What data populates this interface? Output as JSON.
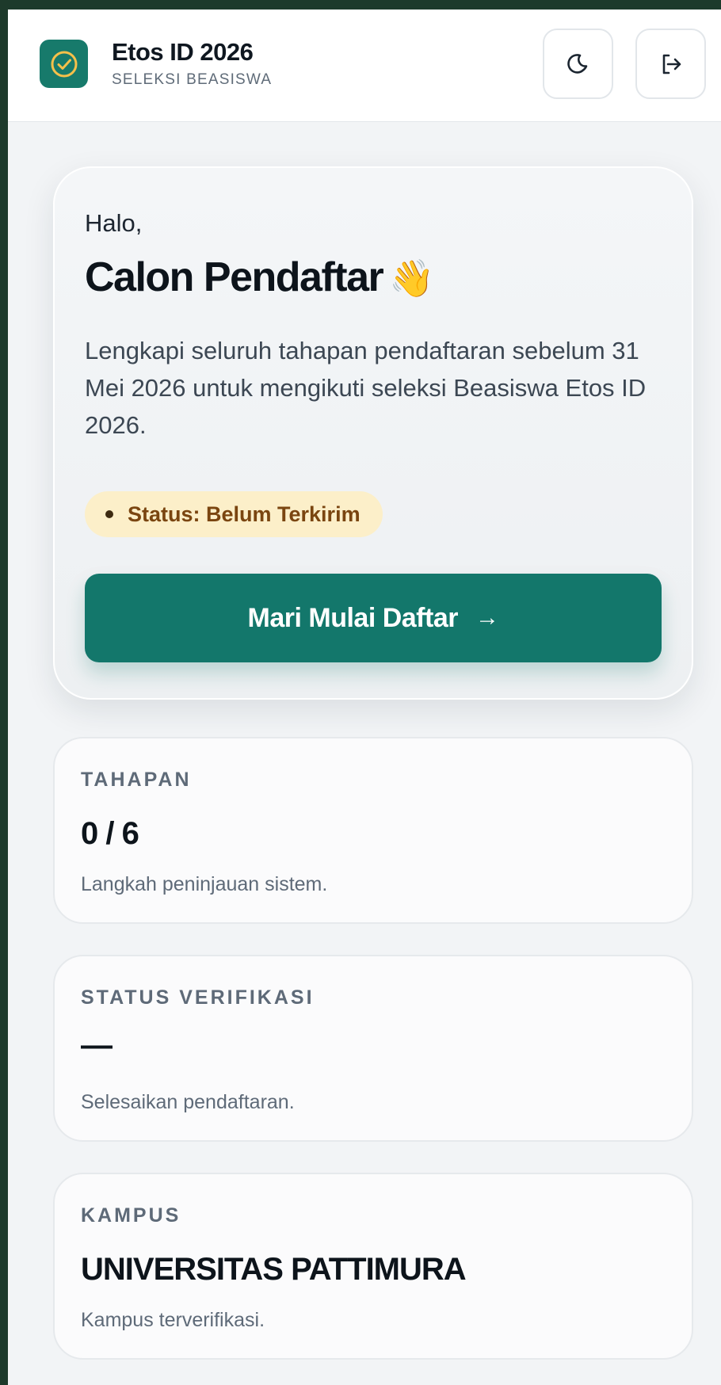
{
  "header": {
    "brand_title": "Etos ID 2026",
    "brand_subtitle": "SELEKSI BEASISWA",
    "logo_icon": "check-circle-icon",
    "theme_icon": "moon-icon",
    "logout_icon": "logout-icon"
  },
  "hero": {
    "greeting": "Halo,",
    "name": "Calon Pendaftar",
    "emoji": "👋",
    "description": "Lengkapi seluruh tahapan pendaftaran sebelum 31 Mei 2026 untuk mengikuti seleksi Beasiswa Etos ID 2026.",
    "status": "Status: Belum Terkirim",
    "cta_label": "Mari Mulai Daftar",
    "cta_arrow": "→"
  },
  "stats": [
    {
      "label": "TAHAPAN",
      "value": "0 / 6",
      "note": "Langkah peninjauan sistem."
    },
    {
      "label": "STATUS VERIFIKASI",
      "value": "—",
      "note": "Selesaikan pendaftaran."
    },
    {
      "label": "KAMPUS",
      "value": "UNIVERSITAS PATTIMURA",
      "note": "Kampus terverifikasi."
    }
  ],
  "colors": {
    "primary": "#13776b",
    "status_bg": "#fcefc9",
    "status_text": "#7a4510",
    "frame": "#1d3a2b"
  }
}
